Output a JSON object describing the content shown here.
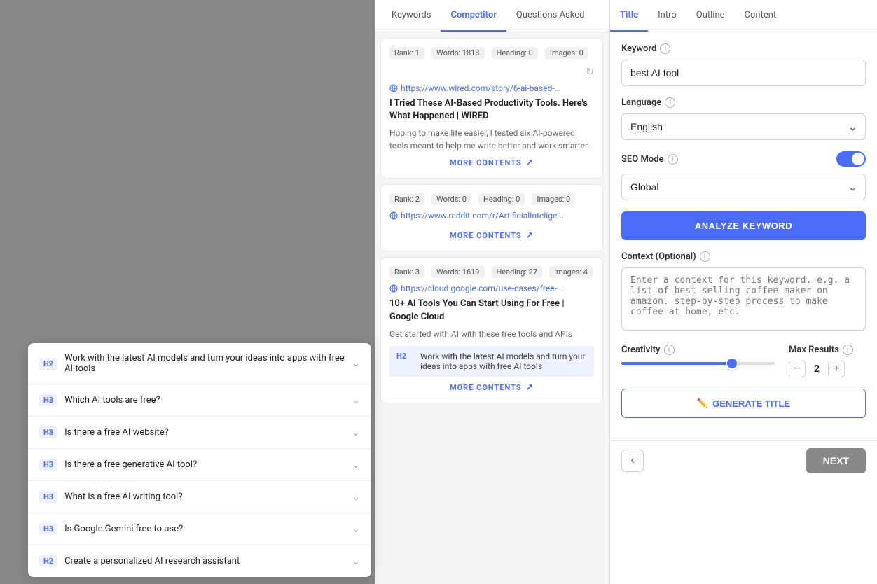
{
  "tabs": {
    "middle": [
      "Keywords",
      "Competitor",
      "Questions Asked"
    ],
    "right": [
      "Title",
      "Intro",
      "Outline",
      "Content"
    ]
  },
  "middle_active_tab": "Competitor",
  "right_active_tab": "Title",
  "competitors": [
    {
      "rank": "Rank: 1",
      "words": "Words: 1818",
      "heading": "Heading: 0",
      "images": "Images: 0",
      "url": "https://www.wired.com/story/6-ai-based-...",
      "title": "I Tried These AI-Based Productivity Tools. Here's What Happened | WIRED",
      "description": "Hoping to make life easier, I tested six AI-powered tools meant to help me write better and work smarter.",
      "more_contents": "MORE CONTENTS"
    },
    {
      "rank": "Rank: 2",
      "words": "Words: 0",
      "heading": "Heading: 0",
      "images": "Images: 0",
      "url": "https://www.reddit.com/r/ArtificialIntelige...",
      "title": "",
      "description": "",
      "more_contents": "MORE CONTENTS"
    },
    {
      "rank": "Rank: 3",
      "words": "Words: 1619",
      "heading": "Heading: 27",
      "images": "Images: 4",
      "url": "https://cloud.google.com/use-cases/free-...",
      "title": "10+ AI Tools You Can Start Using For Free | Google Cloud",
      "description": "Get started with AI with these free tools and APIs",
      "h2_text": "Work with the latest AI models and turn your ideas into apps with free AI tools",
      "more_contents": "MORE CONTENTS"
    }
  ],
  "right": {
    "keyword_label": "Keyword",
    "keyword_value": "best AI tool",
    "language_label": "Language",
    "language_value": "English",
    "seo_mode_label": "SEO Mode",
    "global_value": "Global",
    "analyze_btn": "ANALYZE KEYWORD",
    "context_label": "Context (Optional)",
    "context_placeholder": "Enter a context for this keyword. e.g. a list of best selling coffee maker on amazon. step-by-step process to make coffee at home, etc.",
    "creativity_label": "Creativity",
    "max_results_label": "Max Results",
    "max_results_value": "2",
    "generate_btn": "GENERATE TITLE",
    "next_btn": "NEXT"
  },
  "accordion": {
    "items": [
      {
        "tag": "H2",
        "text": "Work with the latest AI models and turn your ideas into apps with free AI tools",
        "expanded": false
      },
      {
        "tag": "H3",
        "text": "Which AI tools are free?",
        "expanded": false
      },
      {
        "tag": "H3",
        "text": "Is there a free AI website?",
        "expanded": false
      },
      {
        "tag": "H3",
        "text": "Is there a free generative AI tool?",
        "expanded": false
      },
      {
        "tag": "H3",
        "text": "What is a free AI writing tool?",
        "expanded": false
      },
      {
        "tag": "H3",
        "text": "Is Google Gemini free to use?",
        "expanded": false
      },
      {
        "tag": "H2",
        "text": "Create a personalized AI research assistant",
        "expanded": false
      }
    ]
  }
}
